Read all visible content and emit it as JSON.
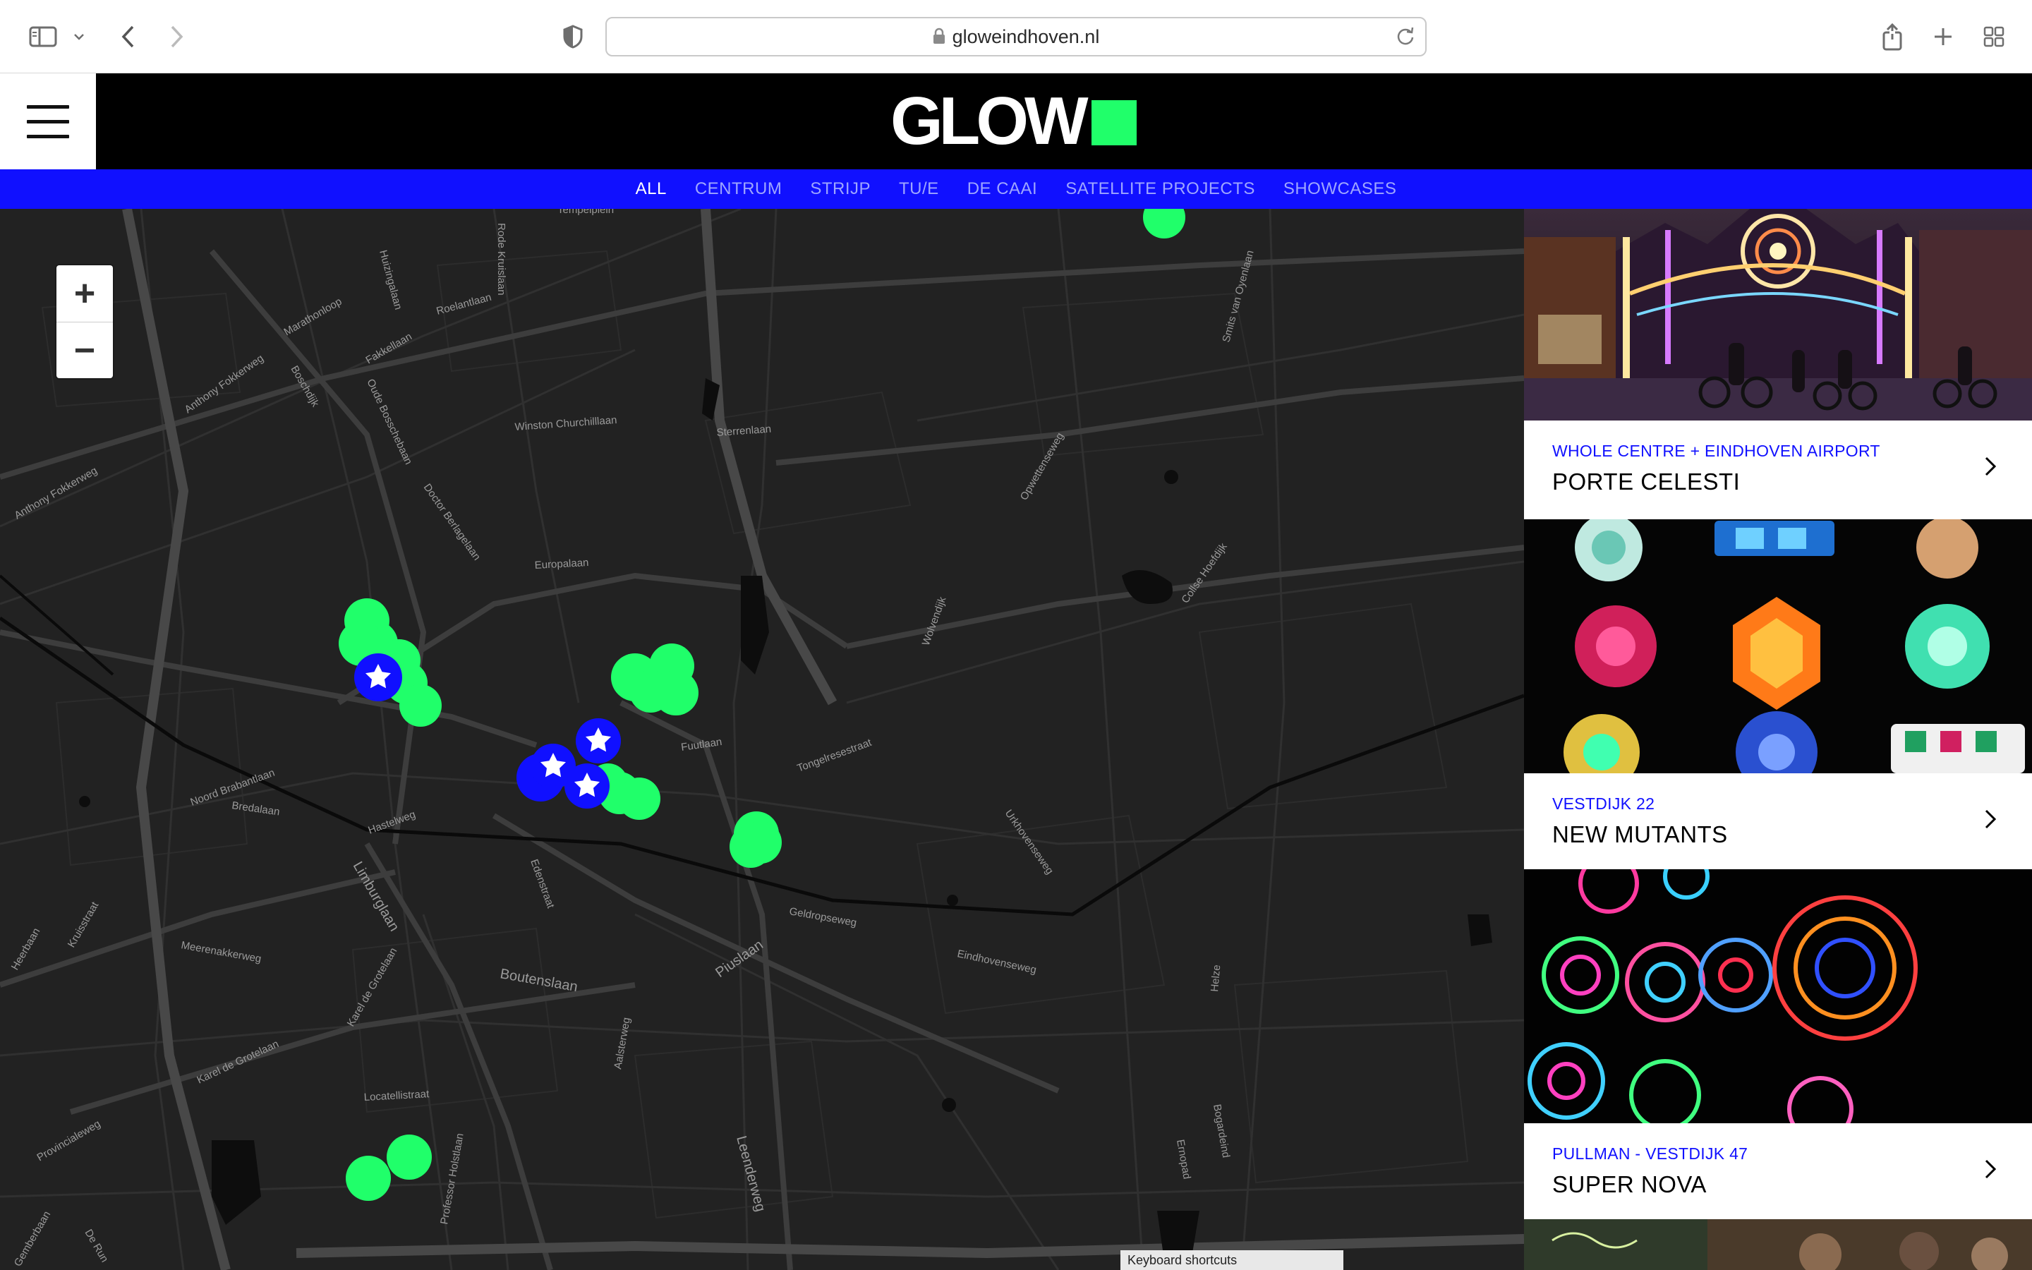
{
  "browser": {
    "url_domain": "gloweindhoven.nl",
    "icons": [
      "sidebar-icon",
      "chevron-down-icon",
      "back-icon",
      "forward-icon",
      "privacy-shield-icon",
      "lock-icon",
      "reload-icon",
      "share-icon",
      "new-tab-icon",
      "tab-overview-icon"
    ]
  },
  "site": {
    "logo_text": "GLOW",
    "brand_green": "#20ff6a",
    "brand_blue": "#1010ff",
    "nav": [
      {
        "label": "ALL",
        "active": true
      },
      {
        "label": "CENTRUM",
        "active": false
      },
      {
        "label": "STRIJP",
        "active": false
      },
      {
        "label": "TU/E",
        "active": false
      },
      {
        "label": "DE CAAI",
        "active": false
      },
      {
        "label": "SATELLITE PROJECTS",
        "active": false
      },
      {
        "label": "SHOWCASES",
        "active": false
      }
    ]
  },
  "map": {
    "zoom_in": "+",
    "zoom_out": "−",
    "keyboard_shortcuts": "Keyboard shortcuts",
    "street_labels": [
      "Tempelplein",
      "Rode Kruislaan",
      "Huizingalaan",
      "Roelantlaan",
      "Marathonloop",
      "Anthony Fokkerweg",
      "Fakkellaan",
      "Boschdijk",
      "Oude Bosschebaan",
      "Winston Churchilllaan",
      "Sterrenlaan",
      "Anthony Fokkerweg",
      "Doctor Berlagelaan",
      "Europalaan",
      "Opwettenseweg",
      "Collse Hoefdijk",
      "Smits van Oyenlaan",
      "Wolvendijk",
      "Fuutlaan",
      "Tongelresestraat",
      "Noord Brabantlaan",
      "Bredalaan",
      "Hastelweg",
      "Limburglaan",
      "Urkhovenseweg",
      "Edenstraat",
      "Geldropseweg",
      "Eindhovenseweg",
      "Meerenakkerweg",
      "Heerbaan",
      "Boutenslaan",
      "Piuslaan",
      "Karel de Grotelaan",
      "Aalsterweg",
      "Helze",
      "Karel de Grotelaan",
      "Locatellistraat",
      "Provincialeweg",
      "Professor Holstlaan",
      "Leenderweg",
      "Bogardeind",
      "Ernopad",
      "Gemberbaan",
      "De Run",
      "Kruisstraat"
    ]
  },
  "events": [
    {
      "location": "WHOLE CENTRE + EINDHOVEN AIRPORT",
      "title": "PORTE CELESTI"
    },
    {
      "location": "VESTDIJK 22",
      "title": "NEW MUTANTS"
    },
    {
      "location": "PULLMAN - VESTDIJK 47",
      "title": "SUPER NOVA"
    }
  ]
}
